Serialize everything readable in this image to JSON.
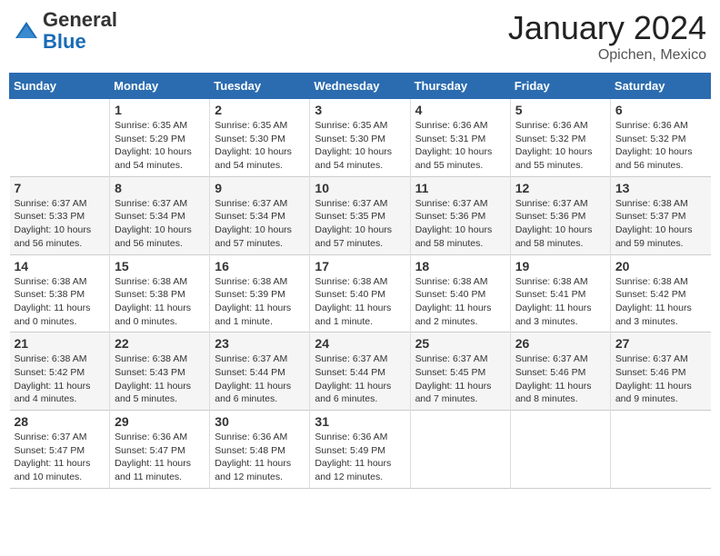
{
  "header": {
    "logo_general": "General",
    "logo_blue": "Blue",
    "month_title": "January 2024",
    "location": "Opichen, Mexico"
  },
  "calendar": {
    "days_of_week": [
      "Sunday",
      "Monday",
      "Tuesday",
      "Wednesday",
      "Thursday",
      "Friday",
      "Saturday"
    ],
    "weeks": [
      [
        {
          "day": "",
          "info": ""
        },
        {
          "day": "1",
          "info": "Sunrise: 6:35 AM\nSunset: 5:29 PM\nDaylight: 10 hours\nand 54 minutes."
        },
        {
          "day": "2",
          "info": "Sunrise: 6:35 AM\nSunset: 5:30 PM\nDaylight: 10 hours\nand 54 minutes."
        },
        {
          "day": "3",
          "info": "Sunrise: 6:35 AM\nSunset: 5:30 PM\nDaylight: 10 hours\nand 54 minutes."
        },
        {
          "day": "4",
          "info": "Sunrise: 6:36 AM\nSunset: 5:31 PM\nDaylight: 10 hours\nand 55 minutes."
        },
        {
          "day": "5",
          "info": "Sunrise: 6:36 AM\nSunset: 5:32 PM\nDaylight: 10 hours\nand 55 minutes."
        },
        {
          "day": "6",
          "info": "Sunrise: 6:36 AM\nSunset: 5:32 PM\nDaylight: 10 hours\nand 56 minutes."
        }
      ],
      [
        {
          "day": "7",
          "info": "Sunrise: 6:37 AM\nSunset: 5:33 PM\nDaylight: 10 hours\nand 56 minutes."
        },
        {
          "day": "8",
          "info": "Sunrise: 6:37 AM\nSunset: 5:34 PM\nDaylight: 10 hours\nand 56 minutes."
        },
        {
          "day": "9",
          "info": "Sunrise: 6:37 AM\nSunset: 5:34 PM\nDaylight: 10 hours\nand 57 minutes."
        },
        {
          "day": "10",
          "info": "Sunrise: 6:37 AM\nSunset: 5:35 PM\nDaylight: 10 hours\nand 57 minutes."
        },
        {
          "day": "11",
          "info": "Sunrise: 6:37 AM\nSunset: 5:36 PM\nDaylight: 10 hours\nand 58 minutes."
        },
        {
          "day": "12",
          "info": "Sunrise: 6:37 AM\nSunset: 5:36 PM\nDaylight: 10 hours\nand 58 minutes."
        },
        {
          "day": "13",
          "info": "Sunrise: 6:38 AM\nSunset: 5:37 PM\nDaylight: 10 hours\nand 59 minutes."
        }
      ],
      [
        {
          "day": "14",
          "info": "Sunrise: 6:38 AM\nSunset: 5:38 PM\nDaylight: 11 hours\nand 0 minutes."
        },
        {
          "day": "15",
          "info": "Sunrise: 6:38 AM\nSunset: 5:38 PM\nDaylight: 11 hours\nand 0 minutes."
        },
        {
          "day": "16",
          "info": "Sunrise: 6:38 AM\nSunset: 5:39 PM\nDaylight: 11 hours\nand 1 minute."
        },
        {
          "day": "17",
          "info": "Sunrise: 6:38 AM\nSunset: 5:40 PM\nDaylight: 11 hours\nand 1 minute."
        },
        {
          "day": "18",
          "info": "Sunrise: 6:38 AM\nSunset: 5:40 PM\nDaylight: 11 hours\nand 2 minutes."
        },
        {
          "day": "19",
          "info": "Sunrise: 6:38 AM\nSunset: 5:41 PM\nDaylight: 11 hours\nand 3 minutes."
        },
        {
          "day": "20",
          "info": "Sunrise: 6:38 AM\nSunset: 5:42 PM\nDaylight: 11 hours\nand 3 minutes."
        }
      ],
      [
        {
          "day": "21",
          "info": "Sunrise: 6:38 AM\nSunset: 5:42 PM\nDaylight: 11 hours\nand 4 minutes."
        },
        {
          "day": "22",
          "info": "Sunrise: 6:38 AM\nSunset: 5:43 PM\nDaylight: 11 hours\nand 5 minutes."
        },
        {
          "day": "23",
          "info": "Sunrise: 6:37 AM\nSunset: 5:44 PM\nDaylight: 11 hours\nand 6 minutes."
        },
        {
          "day": "24",
          "info": "Sunrise: 6:37 AM\nSunset: 5:44 PM\nDaylight: 11 hours\nand 6 minutes."
        },
        {
          "day": "25",
          "info": "Sunrise: 6:37 AM\nSunset: 5:45 PM\nDaylight: 11 hours\nand 7 minutes."
        },
        {
          "day": "26",
          "info": "Sunrise: 6:37 AM\nSunset: 5:46 PM\nDaylight: 11 hours\nand 8 minutes."
        },
        {
          "day": "27",
          "info": "Sunrise: 6:37 AM\nSunset: 5:46 PM\nDaylight: 11 hours\nand 9 minutes."
        }
      ],
      [
        {
          "day": "28",
          "info": "Sunrise: 6:37 AM\nSunset: 5:47 PM\nDaylight: 11 hours\nand 10 minutes."
        },
        {
          "day": "29",
          "info": "Sunrise: 6:36 AM\nSunset: 5:47 PM\nDaylight: 11 hours\nand 11 minutes."
        },
        {
          "day": "30",
          "info": "Sunrise: 6:36 AM\nSunset: 5:48 PM\nDaylight: 11 hours\nand 12 minutes."
        },
        {
          "day": "31",
          "info": "Sunrise: 6:36 AM\nSunset: 5:49 PM\nDaylight: 11 hours\nand 12 minutes."
        },
        {
          "day": "",
          "info": ""
        },
        {
          "day": "",
          "info": ""
        },
        {
          "day": "",
          "info": ""
        }
      ]
    ]
  }
}
